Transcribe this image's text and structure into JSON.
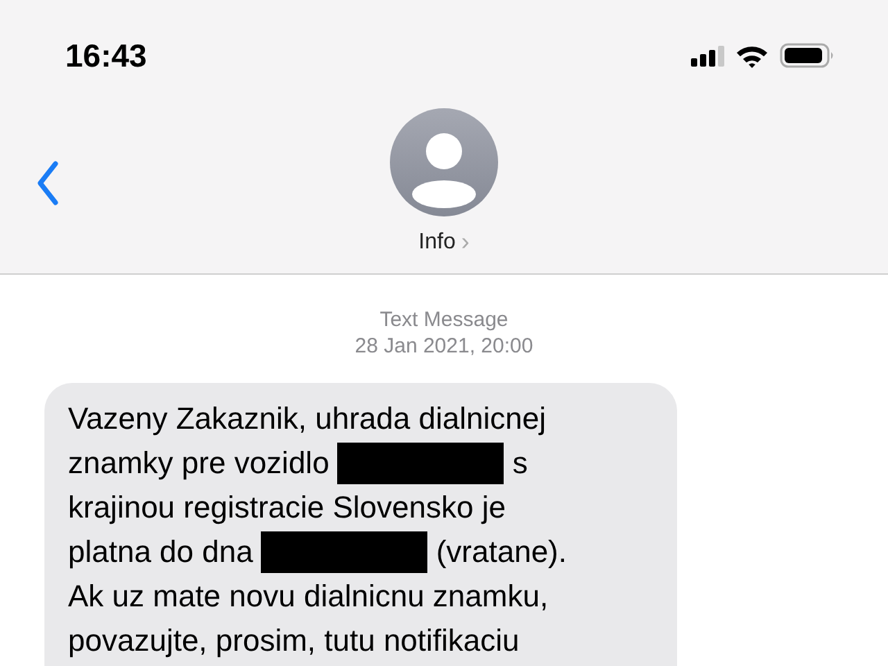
{
  "status_bar": {
    "time": "16:43"
  },
  "header": {
    "contact_label": "Info",
    "chevron": "›"
  },
  "timestamp": {
    "label": "Text Message",
    "date": "28 Jan 2021, 20:00"
  },
  "message": {
    "lines": [
      [
        {
          "kind": "text",
          "text": "Vazeny Zakaznik, uhrada dialnicnej"
        }
      ],
      [
        {
          "kind": "text",
          "text": "znamky pre vozidlo"
        },
        {
          "kind": "redacted"
        },
        {
          "kind": "text",
          "text": "s"
        }
      ],
      [
        {
          "kind": "text",
          "text": "krajinou registracie Slovensko je"
        }
      ],
      [
        {
          "kind": "text",
          "text": "platna do dna"
        },
        {
          "kind": "redacted"
        },
        {
          "kind": "text",
          "text": "(vratane)."
        }
      ],
      [
        {
          "kind": "text",
          "text": "Ak uz mate novu dialnicnu znamku,"
        }
      ],
      [
        {
          "kind": "text",
          "text": "povazujte, prosim, tutu notifikaciu"
        }
      ]
    ]
  }
}
